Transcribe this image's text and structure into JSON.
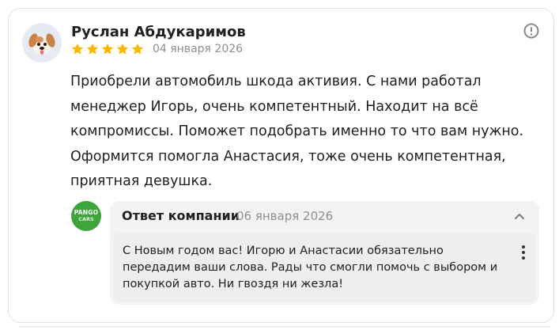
{
  "review": {
    "author": "Руслан Абдукаримов",
    "rating": 5,
    "rating_max": 5,
    "date": "04 января 2026",
    "text": "Приобрели автомобиль шкода активия. С нами работал менеджер Игорь, очень компетентный. Находит на всё компромиссы. Поможет подобрать именно то что вам нужно. Оформится помогла Анастасия, тоже очень компетентная, приятная девушка.",
    "avatar_icon": "puppy-avatar-icon",
    "more_icon": "exclamation-circle-icon"
  },
  "reply": {
    "logo_line1": "PANGO",
    "logo_line2": "CARS",
    "title": "Ответ компании",
    "date": "06 января 2026",
    "text": "С Новым годом вас! Игорю и Анастасии обязательно передадим ваши слова. Рады что смогли помочь с выбором и покупкой авто. Ни гвоздя ни жезла!",
    "collapse_icon": "chevron-up-icon",
    "menu_icon": "kebab-menu-icon"
  },
  "colors": {
    "star": "#fcb800",
    "logo_green": "#3ea53a",
    "text": "#21201f",
    "muted": "#8f8f8f"
  }
}
